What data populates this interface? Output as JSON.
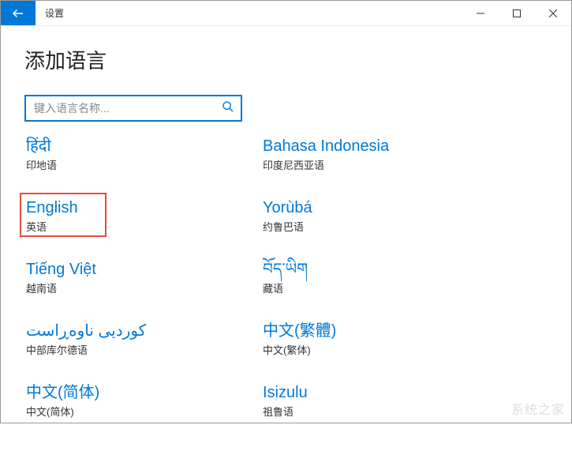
{
  "titlebar": {
    "title": "设置"
  },
  "heading": "添加语言",
  "search": {
    "placeholder": "键入语言名称..."
  },
  "languages": [
    {
      "native": "हिंदी",
      "local": "印地语",
      "highlighted": false
    },
    {
      "native": "Bahasa Indonesia",
      "local": "印度尼西亚语",
      "highlighted": false
    },
    {
      "native": "English",
      "local": "英语",
      "highlighted": true
    },
    {
      "native": "Yorùbá",
      "local": "约鲁巴语",
      "highlighted": false
    },
    {
      "native": "Tiếng Việt",
      "local": "越南语",
      "highlighted": false
    },
    {
      "native": "བོད་ཡིག",
      "local": "藏语",
      "highlighted": false
    },
    {
      "native": "کوردیی ناوەڕاست",
      "local": "中部库尔德语",
      "highlighted": false
    },
    {
      "native": "中文(繁體)",
      "local": "中文(繁体)",
      "highlighted": false
    },
    {
      "native": "中文(简体)",
      "local": "中文(简体)",
      "highlighted": false
    },
    {
      "native": "Isizulu",
      "local": "祖鲁语",
      "highlighted": false
    }
  ],
  "watermark": "系统之家"
}
